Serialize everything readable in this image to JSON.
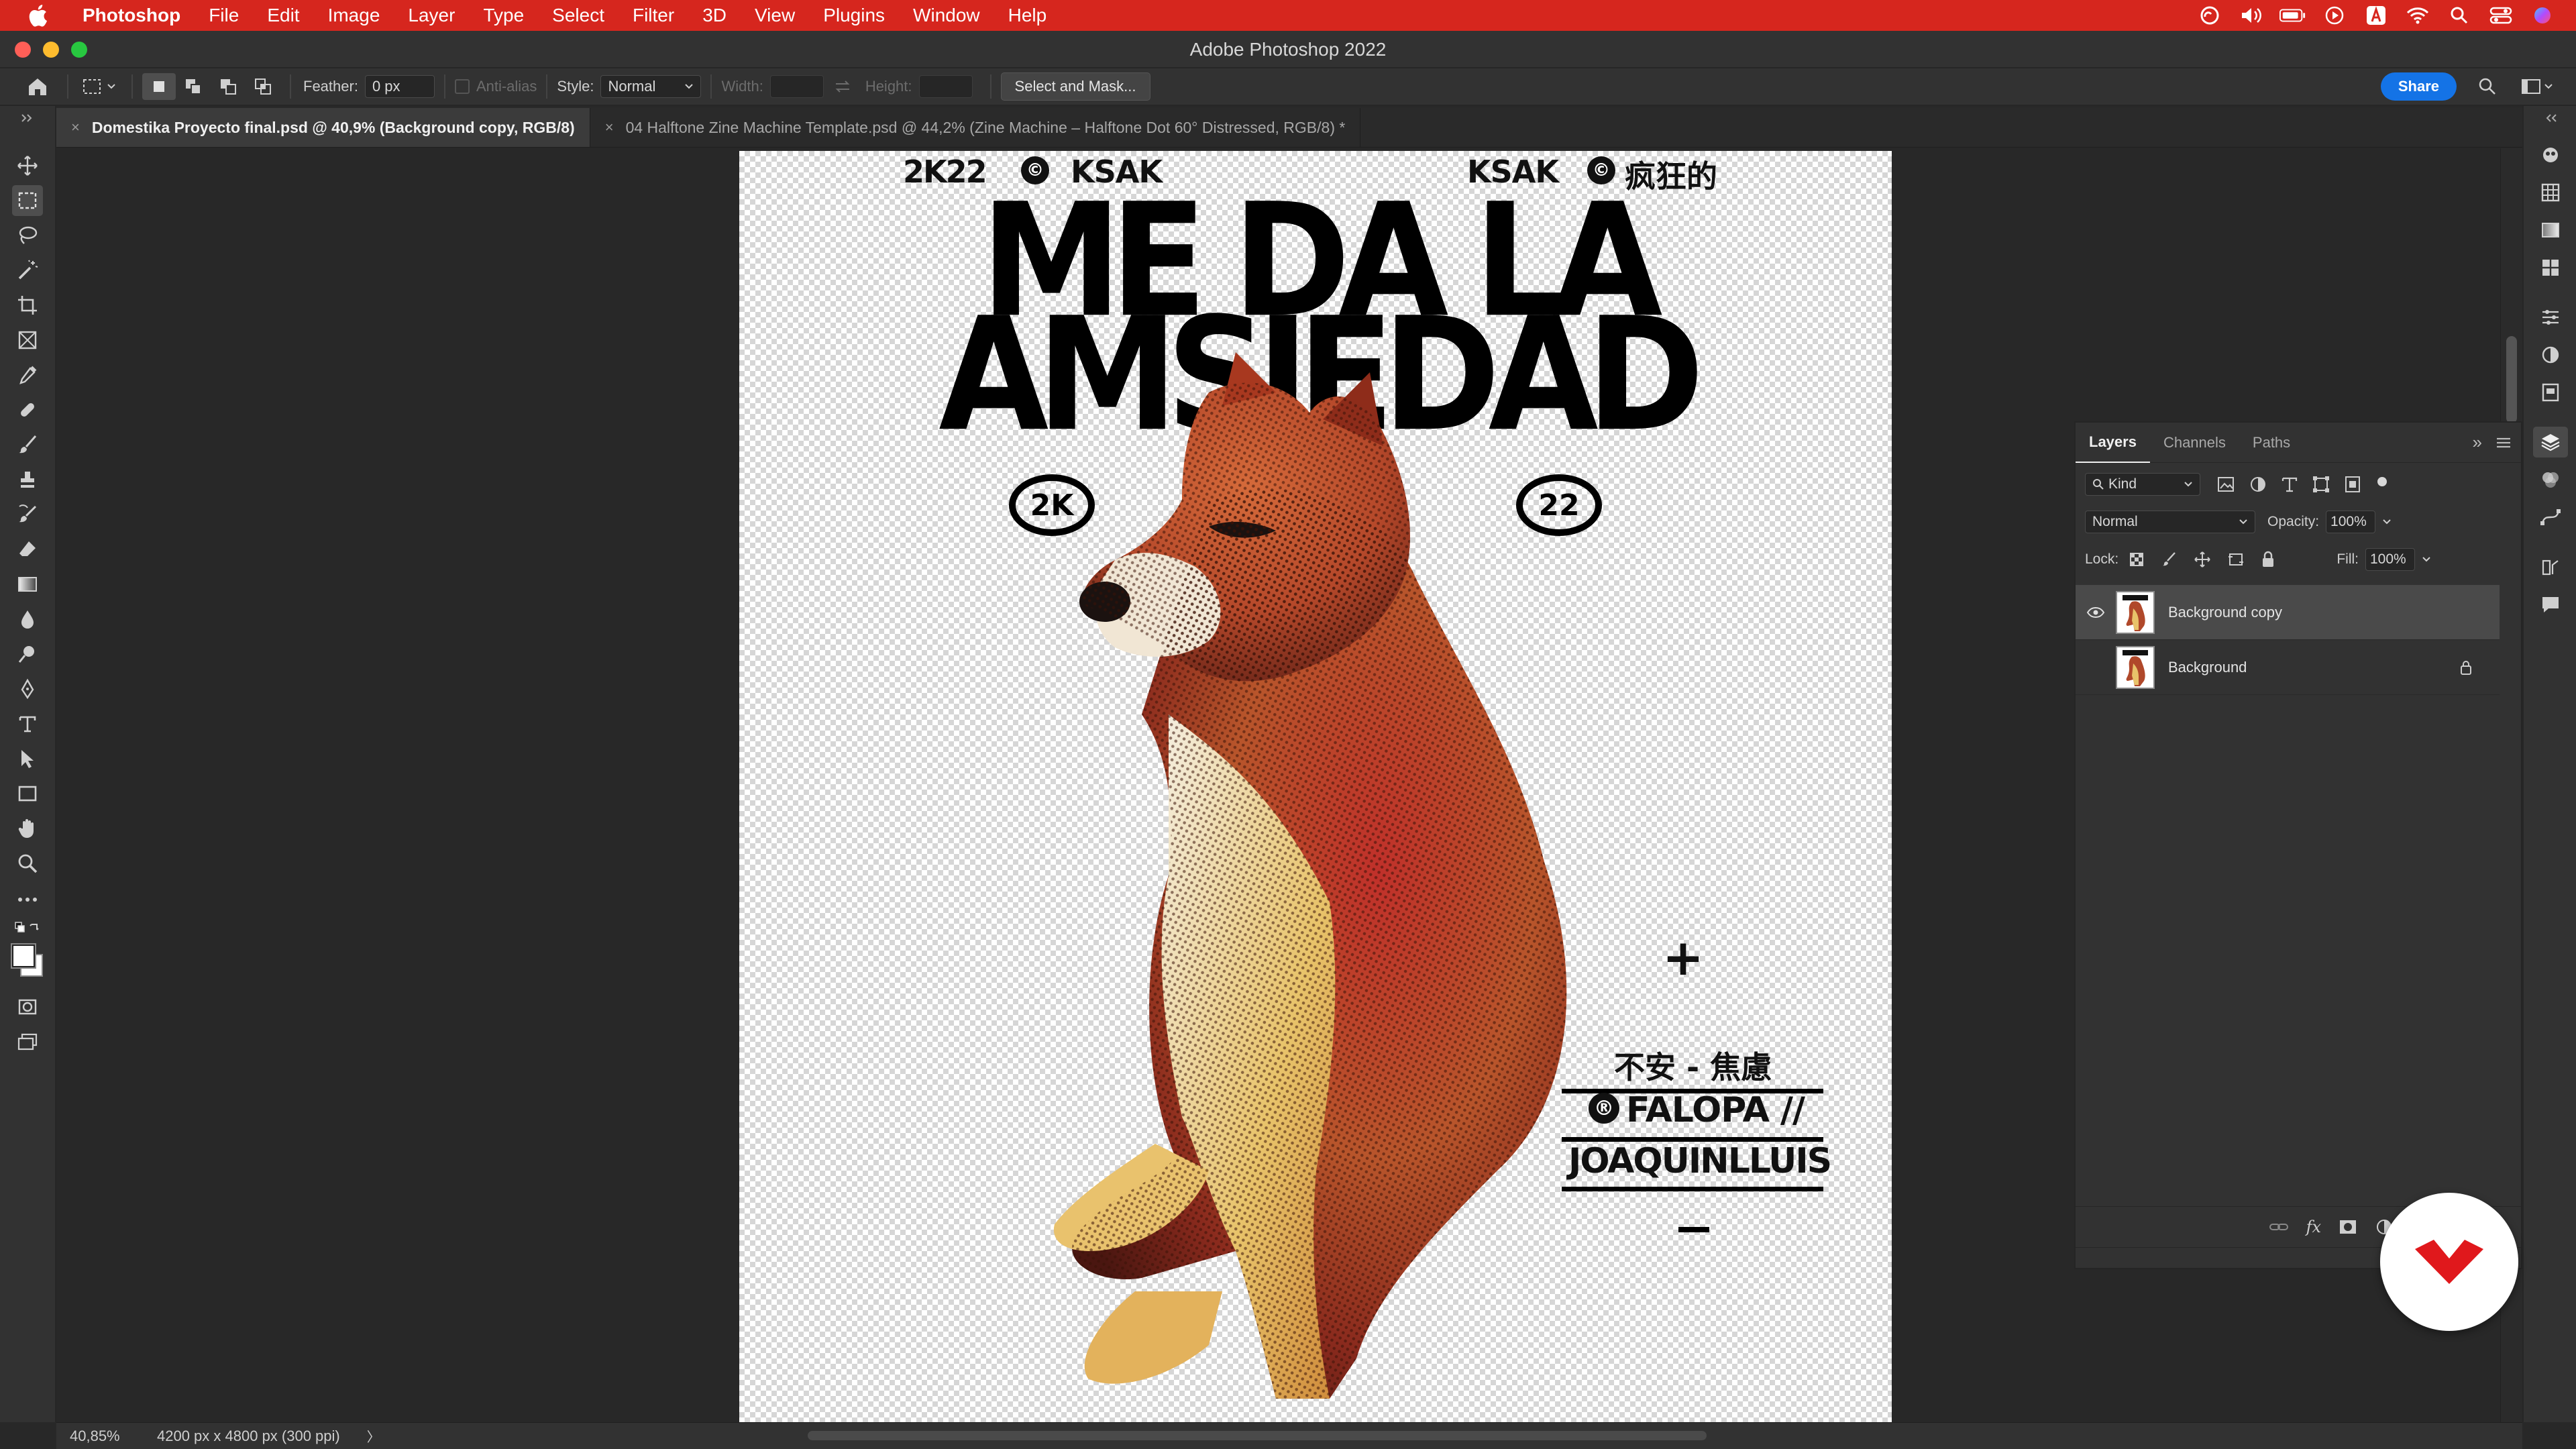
{
  "menubar": {
    "app": "Photoshop",
    "items": [
      "File",
      "Edit",
      "Image",
      "Layer",
      "Type",
      "Select",
      "Filter",
      "3D",
      "View",
      "Plugins",
      "Window",
      "Help"
    ]
  },
  "window": {
    "title": "Adobe Photoshop 2022"
  },
  "options": {
    "feather_label": "Feather:",
    "feather_value": "0 px",
    "antialias_label": "Anti-alias",
    "style_label": "Style:",
    "style_value": "Normal",
    "width_label": "Width:",
    "height_label": "Height:",
    "select_mask": "Select and Mask...",
    "share": "Share"
  },
  "tabs": [
    {
      "label": "Domestika Proyecto final.psd @ 40,9% (Background copy, RGB/8)",
      "active": true
    },
    {
      "label": "04 Halftone Zine Machine Template.psd @ 44,2% (Zine Machine – Halftone Dot 60° Distressed, RGB/8) *",
      "active": false
    }
  ],
  "poster": {
    "top_left_year": "2K22",
    "top_left_name": "KSAK",
    "top_right_name": "KSAK",
    "top_right_cjk": "疯狂的",
    "headline_line1": "ME DA LA",
    "headline_line2": "AMSIEDAD",
    "circle_left": "2K",
    "circle_right": "22",
    "plus": "+",
    "cjk_line": "不安 - 焦慮",
    "credit_1": "FALOPA //",
    "credit_2": "JOAQUINLLUIS",
    "dash": "–"
  },
  "status": {
    "zoom": "40,85%",
    "doc_info": "4200 px x 4800 px (300 ppi)",
    "arrow": "〉"
  },
  "layers_panel": {
    "tabs": [
      "Layers",
      "Channels",
      "Paths"
    ],
    "filter_kind": "Kind",
    "blend_mode": "Normal",
    "opacity_label": "Opacity:",
    "opacity_value": "100%",
    "lock_label": "Lock:",
    "fill_label": "Fill:",
    "fill_value": "100%",
    "layers": [
      {
        "name": "Background copy",
        "visible": true,
        "selected": true
      },
      {
        "name": "Background",
        "visible": false,
        "selected": false,
        "locked": true
      }
    ]
  },
  "colors": {
    "menubar": "#d6261e",
    "share_button": "#1473e6",
    "domestika_red": "#e0181c"
  }
}
